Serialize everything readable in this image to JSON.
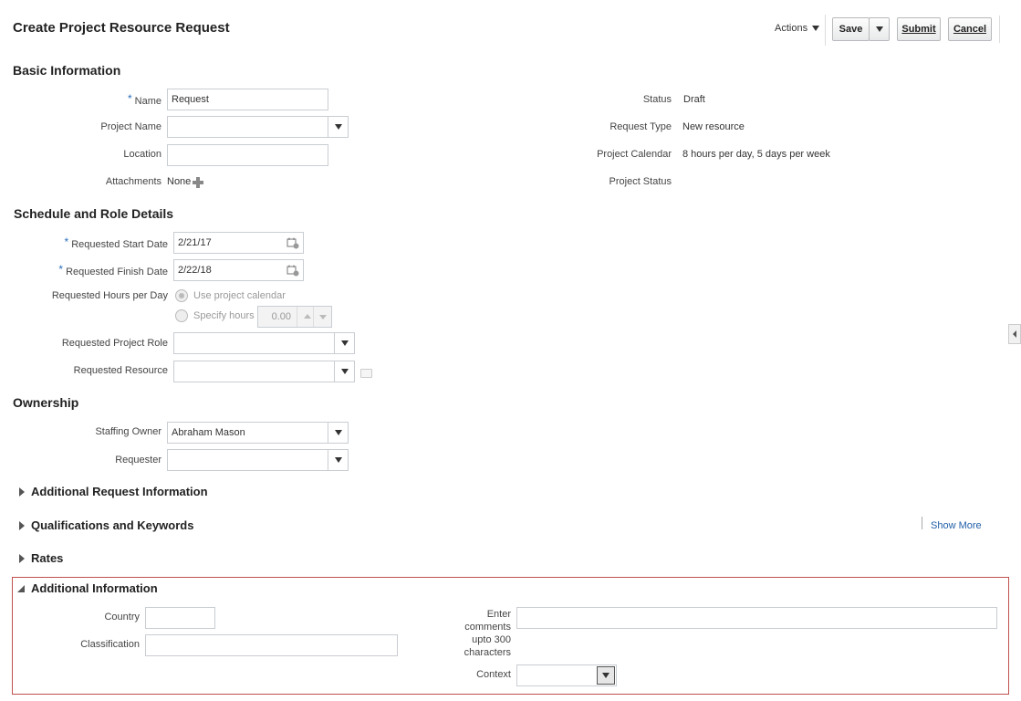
{
  "page": {
    "title": "Create Project Resource Request"
  },
  "toolbar": {
    "actions_label": "Actions",
    "save_label": "Save",
    "submit_label": "Submit",
    "cancel_label": "Cancel"
  },
  "basic": {
    "heading": "Basic Information",
    "name_label": "Name",
    "name_value": "Request",
    "project_name_label": "Project Name",
    "project_name_value": "",
    "location_label": "Location",
    "location_value": "",
    "attachments_label": "Attachments",
    "attachments_value": "None",
    "status_label": "Status",
    "status_value": "Draft",
    "request_type_label": "Request Type",
    "request_type_value": "New resource",
    "calendar_label": "Project Calendar",
    "calendar_value": "8 hours per day, 5 days per week",
    "project_status_label": "Project Status",
    "project_status_value": ""
  },
  "schedule": {
    "heading": "Schedule and Role Details",
    "start_label": "Requested Start Date",
    "start_value": "2/21/17",
    "finish_label": "Requested Finish Date",
    "finish_value": "2/22/18",
    "hours_label": "Requested Hours per Day",
    "opt_calendar": "Use project calendar",
    "opt_specify": "Specify hours",
    "hours_value": "0.00",
    "role_label": "Requested Project Role",
    "role_value": "",
    "resource_label": "Requested Resource",
    "resource_value": ""
  },
  "ownership": {
    "heading": "Ownership",
    "staffing_owner_label": "Staffing Owner",
    "staffing_owner_value": "Abraham Mason",
    "requester_label": "Requester",
    "requester_value": ""
  },
  "sections": {
    "additional_request": "Additional Request Information",
    "qualifications": "Qualifications and Keywords",
    "show_more": "Show More",
    "rates": "Rates"
  },
  "additional": {
    "heading": "Additional Information",
    "country_label": "Country",
    "country_value": "",
    "classification_label": "Classification",
    "classification_value": "",
    "comments_label_1": "Enter",
    "comments_label_2": "comments",
    "comments_label_3": "upto 300",
    "comments_label_4": "characters",
    "comments_value": "",
    "context_label": "Context",
    "context_value": ""
  },
  "colors": {
    "accent": "#2a6ebb",
    "highlight_border": "#c0504d",
    "link": "#1f5fa8"
  }
}
